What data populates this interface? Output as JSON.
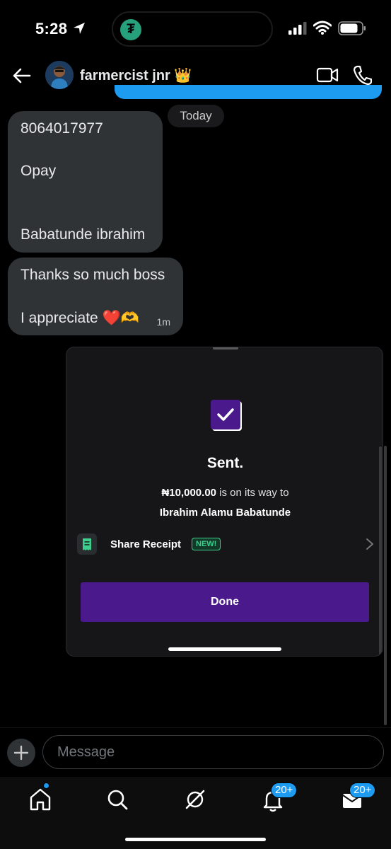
{
  "status_bar": {
    "time": "5:28"
  },
  "header": {
    "contact_name": "farmercist jnr",
    "name_emoji": "👑"
  },
  "chat": {
    "date_label": "Today",
    "message_1": {
      "lines": [
        "8064017977",
        "Opay",
        "Babatunde ibrahim"
      ]
    },
    "message_2": {
      "line_1": "Thanks so much boss",
      "line_2": "I appreciate",
      "emoji": "❤️🫶",
      "time": "1m"
    }
  },
  "receipt_card": {
    "title": "Sent.",
    "amount": "₦10,000.00",
    "on_way_text": " is on its way to",
    "recipient": "Ibrahim Alamu Babatunde",
    "share_label": "Share Receipt",
    "new_badge": "NEW!",
    "done_label": "Done",
    "accent_color": "#4a1a8c",
    "badge_color": "#3ecf8e"
  },
  "composer": {
    "placeholder": "Message"
  },
  "bottom_nav": {
    "items": [
      "home-icon",
      "search-icon",
      "grok-icon",
      "notifications-icon",
      "messages-icon"
    ],
    "notifications_badge": "20+",
    "messages_badge": "20+",
    "accent_color": "#1d9bf0"
  }
}
